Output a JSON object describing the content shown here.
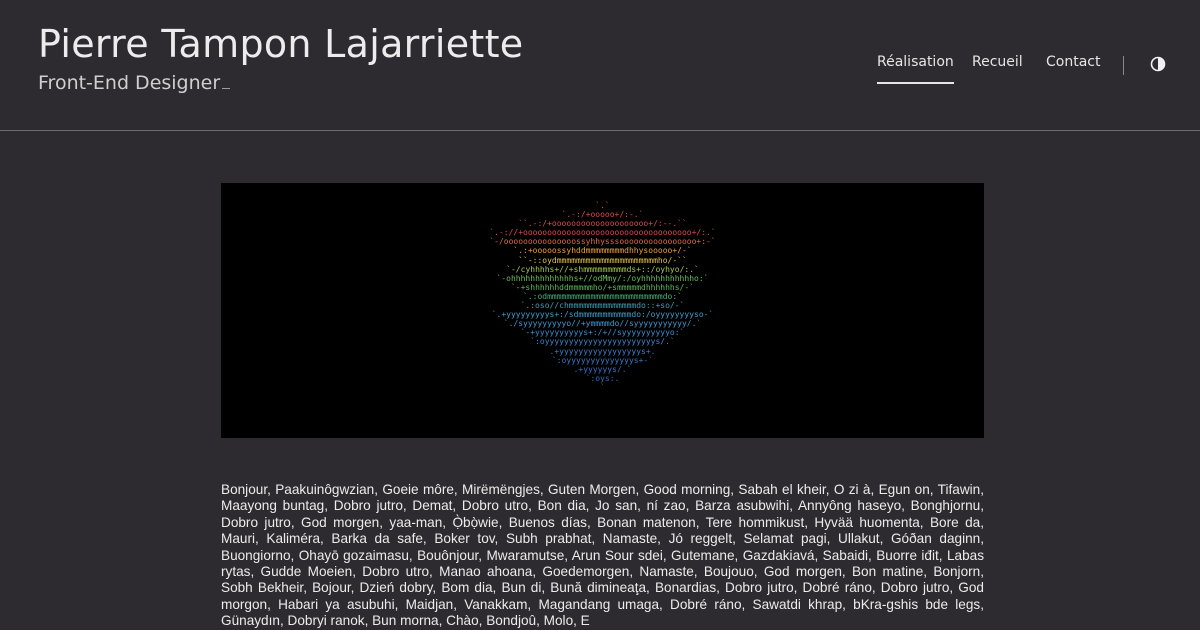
{
  "header": {
    "title": "Pierre Tampon Lajarriette",
    "subtitle": "Front-End Designer"
  },
  "nav": {
    "items": [
      {
        "label": "Réalisation",
        "active": true
      },
      {
        "label": "Recueil",
        "active": false
      },
      {
        "label": "Contact",
        "active": false
      }
    ],
    "theme_toggle_icon": "half-circle-contrast-icon"
  },
  "banner": {
    "ascii_lines": [
      {
        "text": "`.`",
        "color": "#e0484f"
      },
      {
        "text": "`.-:/+ooooo+/:-.`",
        "color": "#e0484f"
      },
      {
        "text": "``.-:/+oooooooooooooooooooo+/:--.``",
        "color": "#e0484f"
      },
      {
        "text": "`.-://+ooooooooooooooooooooooooooooooooooo+/:.`",
        "color": "#e0484f"
      },
      {
        "text": "`-/ooooooooooooooossyhhysssoooooooooooooooo+:-`",
        "color": "#e8684a"
      },
      {
        "text": "`.:+ooooossyhddmmmmmmmmdhhysooooo+/-`",
        "color": "#f0a040"
      },
      {
        "text": "``-::oydmmmmmmmmmmmmmmmmmmmmmho/-``",
        "color": "#e8c24a"
      },
      {
        "text": "`-/cyhhhhs+//+shmmmmmmmmmds+::/oyhyo/:.`",
        "color": "#a8c850"
      },
      {
        "text": "`-ohhhhhhhhhhhhhs+//odMmy/:/oyhhhhhhhhhhho:`",
        "color": "#6dbf5a"
      },
      {
        "text": "`-+shhhhhhddmmmmmho/+smmmmmdhhhhhhs/-`",
        "color": "#5cb85c"
      },
      {
        "text": "`.:odmmmmmmmmmmmmmmmmmmmmmmmmdo:`",
        "color": "#4caf7a"
      },
      {
        "text": "`.:oso//chmmmmmmmmmmmmmmdo::+so/-`",
        "color": "#40a0b8"
      },
      {
        "text": "`.+yyyyyyyyys+:/sdmmmmmmmmmmmdo:/oyyyyyyyyso-`",
        "color": "#3fa0d0"
      },
      {
        "text": "`./syyyyyyyyyo//+ymmmmdo//syyyyyyyyyyy/.`",
        "color": "#3f9ad6"
      },
      {
        "text": "`-+yyyyyyyyyys+:/+//syyyyyyyyyyo:`",
        "color": "#3a8fd6"
      },
      {
        "text": "`:oyyyyyyyyyyyyyyyyyyyyyyys/.`",
        "color": "#3a86d2"
      },
      {
        "text": ".+yyyyyyyyyyyyyyyyys+.",
        "color": "#3a7fcf"
      },
      {
        "text": "`:oyyyyyyyyyyyyyys+-`",
        "color": "#3a78cc"
      },
      {
        "text": ".+yyyyyys/.`",
        "color": "#3a70c8"
      },
      {
        "text": "`:oys:.",
        "color": "#3a68c4"
      },
      {
        "text": "`",
        "color": "#3a62c0"
      }
    ]
  },
  "intro": {
    "text": "Bonjour, Paakuinôgwzian, Goeie môre, Mirëmëngjes, Guten Morgen, Good morning, Sabah el kheir, O zi à, Egun on, Tifawin, Maayong buntag, Dobro jutro, Demat, Dobro utro, Bon dia, Jo san, ní zao, Barza asubwihi, Annyông haseyo, Bonghjornu, Dobro jutro, God morgen, yaa-man, Ọ̀bọ̀wie, Buenos días, Bonan matenon, Tere hommikust, Hyvää huomenta, Bore da, Mauri, Kaliméra, Barka da safe, Boker tov, Subh prabhat, Namaste, Jó reggelt, Selamat pagi, Ullakut, Góðan daginn, Buongiorno, Ohayō gozaimasu, Bouônjour, Mwaramutse, Arun Sour sdei, Gutemane, Gazdakiavá, Sabaidi, Buorre iđit, Labas rytas, Gudde Moeien, Dobro utro, Manao ahoana, Goedemorgen, Namaste, Boujouo, God morgen, Bon matine, Bonjorn, Sobh Bekheir, Bojour, Dzień dobry, Bom dia, Bun di, Bună dimineaţa, Bonardias, Dobro jutro, Dobré ráno, Dobro jutro, God morgon, Habari ya asubuhi, Maidjan, Vanakkam, Magandang umaga, Dobré ráno, Sawatdi khrap, bKra-gshis bde legs, Günaydın, Dobryi ranok, Bun morna, Chào, Bondjoû, Molo, E"
  }
}
